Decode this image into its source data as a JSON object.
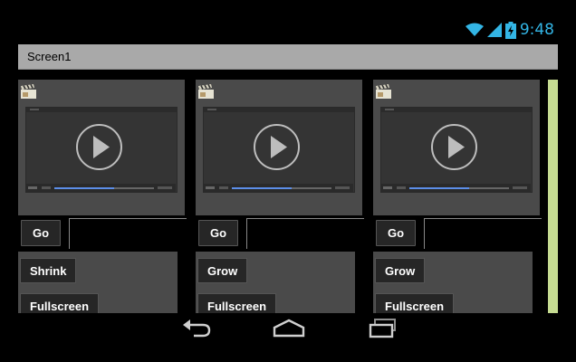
{
  "status_bar": {
    "time": "9:48",
    "icons": [
      "wifi-icon",
      "signal-icon",
      "battery-charging-icon"
    ],
    "accent_color": "#33b5e5"
  },
  "title_bar": {
    "title": "Screen1"
  },
  "columns": [
    {
      "go_label": "Go",
      "action1_label": "Shrink",
      "action2_label": "Fullscreen",
      "progress": 0.6
    },
    {
      "go_label": "Go",
      "action1_label": "Grow",
      "action2_label": "Fullscreen",
      "progress": 0.6
    },
    {
      "go_label": "Go",
      "action1_label": "Grow",
      "action2_label": "Fullscreen",
      "progress": 0.6
    }
  ],
  "nav_bar": {
    "icons": [
      "back-icon",
      "home-icon",
      "recent-apps-icon"
    ]
  }
}
